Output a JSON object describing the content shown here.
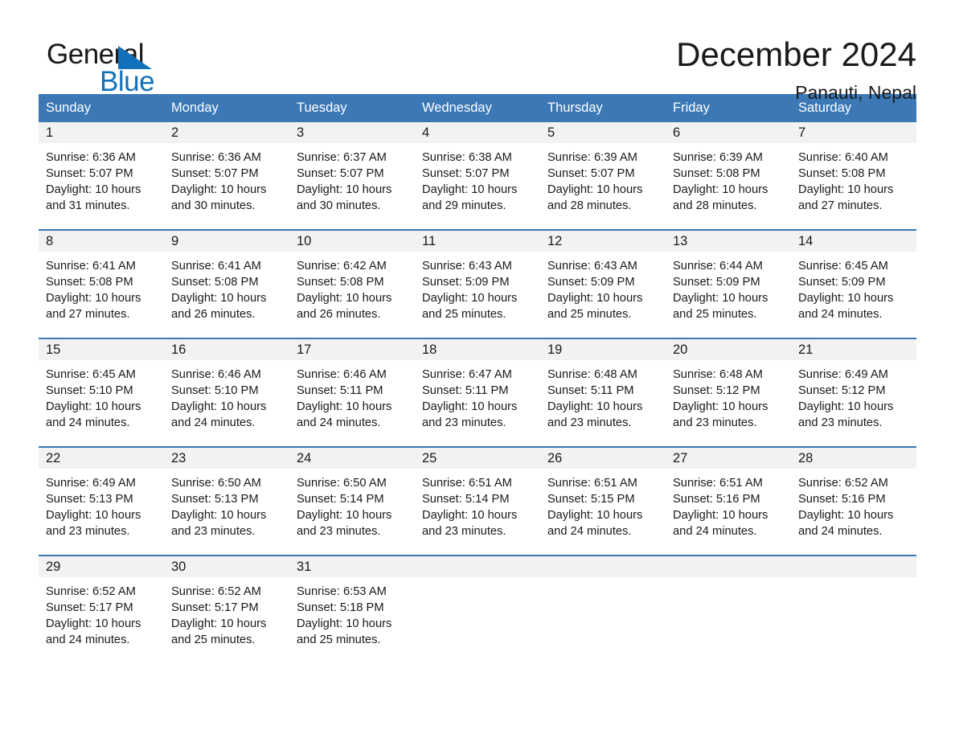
{
  "brand": {
    "name_part1": "General",
    "name_part2": "Blue",
    "accent_color": "#1271bb"
  },
  "header": {
    "month_title": "December 2024",
    "location": "Panauti, Nepal"
  },
  "calendar": {
    "header_color": "#3b78b5",
    "daynum_band_color": "#f2f2f2",
    "weekday_headers": [
      "Sunday",
      "Monday",
      "Tuesday",
      "Wednesday",
      "Thursday",
      "Friday",
      "Saturday"
    ],
    "weeks": [
      [
        {
          "day": "1",
          "sunrise": "Sunrise: 6:36 AM",
          "sunset": "Sunset: 5:07 PM",
          "daylight_line1": "Daylight: 10 hours",
          "daylight_line2": "and 31 minutes."
        },
        {
          "day": "2",
          "sunrise": "Sunrise: 6:36 AM",
          "sunset": "Sunset: 5:07 PM",
          "daylight_line1": "Daylight: 10 hours",
          "daylight_line2": "and 30 minutes."
        },
        {
          "day": "3",
          "sunrise": "Sunrise: 6:37 AM",
          "sunset": "Sunset: 5:07 PM",
          "daylight_line1": "Daylight: 10 hours",
          "daylight_line2": "and 30 minutes."
        },
        {
          "day": "4",
          "sunrise": "Sunrise: 6:38 AM",
          "sunset": "Sunset: 5:07 PM",
          "daylight_line1": "Daylight: 10 hours",
          "daylight_line2": "and 29 minutes."
        },
        {
          "day": "5",
          "sunrise": "Sunrise: 6:39 AM",
          "sunset": "Sunset: 5:07 PM",
          "daylight_line1": "Daylight: 10 hours",
          "daylight_line2": "and 28 minutes."
        },
        {
          "day": "6",
          "sunrise": "Sunrise: 6:39 AM",
          "sunset": "Sunset: 5:08 PM",
          "daylight_line1": "Daylight: 10 hours",
          "daylight_line2": "and 28 minutes."
        },
        {
          "day": "7",
          "sunrise": "Sunrise: 6:40 AM",
          "sunset": "Sunset: 5:08 PM",
          "daylight_line1": "Daylight: 10 hours",
          "daylight_line2": "and 27 minutes."
        }
      ],
      [
        {
          "day": "8",
          "sunrise": "Sunrise: 6:41 AM",
          "sunset": "Sunset: 5:08 PM",
          "daylight_line1": "Daylight: 10 hours",
          "daylight_line2": "and 27 minutes."
        },
        {
          "day": "9",
          "sunrise": "Sunrise: 6:41 AM",
          "sunset": "Sunset: 5:08 PM",
          "daylight_line1": "Daylight: 10 hours",
          "daylight_line2": "and 26 minutes."
        },
        {
          "day": "10",
          "sunrise": "Sunrise: 6:42 AM",
          "sunset": "Sunset: 5:08 PM",
          "daylight_line1": "Daylight: 10 hours",
          "daylight_line2": "and 26 minutes."
        },
        {
          "day": "11",
          "sunrise": "Sunrise: 6:43 AM",
          "sunset": "Sunset: 5:09 PM",
          "daylight_line1": "Daylight: 10 hours",
          "daylight_line2": "and 25 minutes."
        },
        {
          "day": "12",
          "sunrise": "Sunrise: 6:43 AM",
          "sunset": "Sunset: 5:09 PM",
          "daylight_line1": "Daylight: 10 hours",
          "daylight_line2": "and 25 minutes."
        },
        {
          "day": "13",
          "sunrise": "Sunrise: 6:44 AM",
          "sunset": "Sunset: 5:09 PM",
          "daylight_line1": "Daylight: 10 hours",
          "daylight_line2": "and 25 minutes."
        },
        {
          "day": "14",
          "sunrise": "Sunrise: 6:45 AM",
          "sunset": "Sunset: 5:09 PM",
          "daylight_line1": "Daylight: 10 hours",
          "daylight_line2": "and 24 minutes."
        }
      ],
      [
        {
          "day": "15",
          "sunrise": "Sunrise: 6:45 AM",
          "sunset": "Sunset: 5:10 PM",
          "daylight_line1": "Daylight: 10 hours",
          "daylight_line2": "and 24 minutes."
        },
        {
          "day": "16",
          "sunrise": "Sunrise: 6:46 AM",
          "sunset": "Sunset: 5:10 PM",
          "daylight_line1": "Daylight: 10 hours",
          "daylight_line2": "and 24 minutes."
        },
        {
          "day": "17",
          "sunrise": "Sunrise: 6:46 AM",
          "sunset": "Sunset: 5:11 PM",
          "daylight_line1": "Daylight: 10 hours",
          "daylight_line2": "and 24 minutes."
        },
        {
          "day": "18",
          "sunrise": "Sunrise: 6:47 AM",
          "sunset": "Sunset: 5:11 PM",
          "daylight_line1": "Daylight: 10 hours",
          "daylight_line2": "and 23 minutes."
        },
        {
          "day": "19",
          "sunrise": "Sunrise: 6:48 AM",
          "sunset": "Sunset: 5:11 PM",
          "daylight_line1": "Daylight: 10 hours",
          "daylight_line2": "and 23 minutes."
        },
        {
          "day": "20",
          "sunrise": "Sunrise: 6:48 AM",
          "sunset": "Sunset: 5:12 PM",
          "daylight_line1": "Daylight: 10 hours",
          "daylight_line2": "and 23 minutes."
        },
        {
          "day": "21",
          "sunrise": "Sunrise: 6:49 AM",
          "sunset": "Sunset: 5:12 PM",
          "daylight_line1": "Daylight: 10 hours",
          "daylight_line2": "and 23 minutes."
        }
      ],
      [
        {
          "day": "22",
          "sunrise": "Sunrise: 6:49 AM",
          "sunset": "Sunset: 5:13 PM",
          "daylight_line1": "Daylight: 10 hours",
          "daylight_line2": "and 23 minutes."
        },
        {
          "day": "23",
          "sunrise": "Sunrise: 6:50 AM",
          "sunset": "Sunset: 5:13 PM",
          "daylight_line1": "Daylight: 10 hours",
          "daylight_line2": "and 23 minutes."
        },
        {
          "day": "24",
          "sunrise": "Sunrise: 6:50 AM",
          "sunset": "Sunset: 5:14 PM",
          "daylight_line1": "Daylight: 10 hours",
          "daylight_line2": "and 23 minutes."
        },
        {
          "day": "25",
          "sunrise": "Sunrise: 6:51 AM",
          "sunset": "Sunset: 5:14 PM",
          "daylight_line1": "Daylight: 10 hours",
          "daylight_line2": "and 23 minutes."
        },
        {
          "day": "26",
          "sunrise": "Sunrise: 6:51 AM",
          "sunset": "Sunset: 5:15 PM",
          "daylight_line1": "Daylight: 10 hours",
          "daylight_line2": "and 24 minutes."
        },
        {
          "day": "27",
          "sunrise": "Sunrise: 6:51 AM",
          "sunset": "Sunset: 5:16 PM",
          "daylight_line1": "Daylight: 10 hours",
          "daylight_line2": "and 24 minutes."
        },
        {
          "day": "28",
          "sunrise": "Sunrise: 6:52 AM",
          "sunset": "Sunset: 5:16 PM",
          "daylight_line1": "Daylight: 10 hours",
          "daylight_line2": "and 24 minutes."
        }
      ],
      [
        {
          "day": "29",
          "sunrise": "Sunrise: 6:52 AM",
          "sunset": "Sunset: 5:17 PM",
          "daylight_line1": "Daylight: 10 hours",
          "daylight_line2": "and 24 minutes."
        },
        {
          "day": "30",
          "sunrise": "Sunrise: 6:52 AM",
          "sunset": "Sunset: 5:17 PM",
          "daylight_line1": "Daylight: 10 hours",
          "daylight_line2": "and 25 minutes."
        },
        {
          "day": "31",
          "sunrise": "Sunrise: 6:53 AM",
          "sunset": "Sunset: 5:18 PM",
          "daylight_line1": "Daylight: 10 hours",
          "daylight_line2": "and 25 minutes."
        },
        {
          "day": "",
          "sunrise": "",
          "sunset": "",
          "daylight_line1": "",
          "daylight_line2": ""
        },
        {
          "day": "",
          "sunrise": "",
          "sunset": "",
          "daylight_line1": "",
          "daylight_line2": ""
        },
        {
          "day": "",
          "sunrise": "",
          "sunset": "",
          "daylight_line1": "",
          "daylight_line2": ""
        },
        {
          "day": "",
          "sunrise": "",
          "sunset": "",
          "daylight_line1": "",
          "daylight_line2": ""
        }
      ]
    ]
  }
}
